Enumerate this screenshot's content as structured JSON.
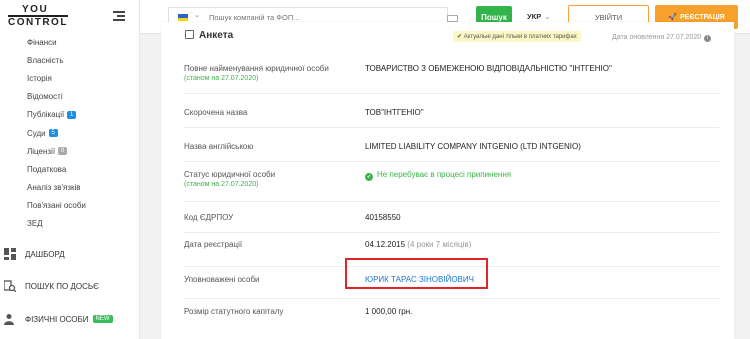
{
  "logo": {
    "line1": "YOU",
    "line2": "CONTROL"
  },
  "sidebar": {
    "subnav": [
      {
        "label": "Фінанси"
      },
      {
        "label": "Власність"
      },
      {
        "label": "Історія"
      },
      {
        "label": "Відомості"
      },
      {
        "label": "Публікації",
        "badge": "1",
        "badge_color": "blue"
      },
      {
        "label": "Суди",
        "badge": "5",
        "badge_color": "blue"
      },
      {
        "label": "Ліцензії",
        "badge": "0",
        "badge_color": "grey"
      },
      {
        "label": "Податкова"
      },
      {
        "label": "Аналіз зв'язків"
      },
      {
        "label": "Пов'язані особи"
      },
      {
        "label": "ЗЕД"
      }
    ],
    "mainnav": [
      {
        "label": "Дашборд",
        "icon": "dashboard-icon"
      },
      {
        "label": "Пошук по досьє",
        "icon": "search-dossier-icon"
      },
      {
        "label": "Фізичні особи",
        "icon": "person-icon",
        "badge": "NEW"
      }
    ]
  },
  "topbar": {
    "search_placeholder": "Пошук компаній та ФОП...",
    "search_button": "Пошук",
    "language": "УКР",
    "login": "УВІЙТИ",
    "register": "РЕЄСТРАЦІЯ"
  },
  "card": {
    "title": "Анкета",
    "actual_note": "Актуальні дані тільки в платних тарифах",
    "updated": "Дата оновлення 27.07.2020",
    "rows": [
      {
        "label": "Повне найменування юридичної особи",
        "sub": "(станом на 27.07.2020)",
        "value": "ТОВАРИСТВО З ОБМЕЖЕНОЮ ВІДПОВІДАЛЬНІСТЮ \"ІНТГЕНІО\""
      },
      {
        "label": "Скорочена назва",
        "value": "ТОВ\"ІНТГЕНІО\""
      },
      {
        "label": "Назва англійською",
        "value": "LIMITED LIABILITY COMPANY INTGENIO (LTD INTGENIO)"
      },
      {
        "label": "Статус юридичної особи",
        "sub": "(станом на 27.07.2020)",
        "value": "Не перебуває в процесі припинення"
      },
      {
        "label": "Код ЄДРПОУ",
        "value": "40158550"
      },
      {
        "label": "Дата реєстрації",
        "value": "04.12.2015",
        "value_extra": "(4 роки 7 місяців)"
      },
      {
        "label": "Уповноважені особи",
        "value": "ЮРИК ТАРАС ЗІНОВІЙОВИЧ"
      },
      {
        "label": "Розмір статутного капіталу",
        "value": "1 000,00 грн."
      }
    ]
  },
  "colors": {
    "accent_green": "#32b44a",
    "accent_orange": "#f6a12c",
    "link_blue": "#1b75d0",
    "highlight_red": "#e0242a"
  }
}
